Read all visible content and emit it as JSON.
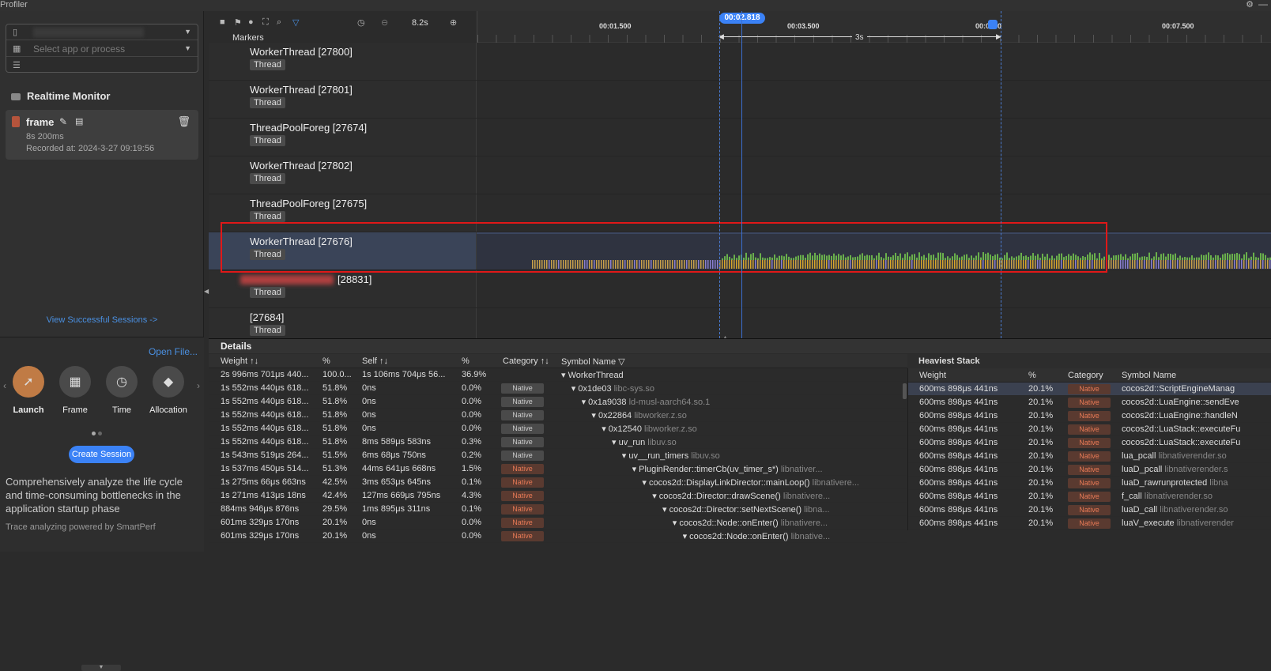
{
  "window": {
    "title": "Profiler"
  },
  "sidebar": {
    "selector_placeholder": "Select app or process",
    "realtime_monitor": "Realtime Monitor",
    "session": {
      "name": "frame",
      "duration": "8s 200ms",
      "recorded": "Recorded at: 2024-3-27 09:19:56"
    },
    "view_sessions": "View Successful Sessions ->",
    "open_file": "Open File...",
    "templates": [
      {
        "label": "Launch",
        "icon": "rocket-icon",
        "glyph": "🚀"
      },
      {
        "label": "Frame",
        "icon": "frame-icon",
        "glyph": "▦"
      },
      {
        "label": "Time",
        "icon": "clock-icon",
        "glyph": "●"
      },
      {
        "label": "Allocation",
        "icon": "cube-icon",
        "glyph": "◆"
      }
    ],
    "create_session": "Create Session",
    "description": "Comprehensively analyze the life cycle and time-consuming bottlenecks in the application startup phase",
    "powered": "Trace analyzing powered by SmartPerf"
  },
  "toolbar": {
    "duration": "8.2s",
    "markers": "Markers"
  },
  "ruler": {
    "ticks": [
      "00:01.500",
      "00:03.500",
      "00:0",
      "500",
      "00:07.500"
    ],
    "cursor": "00:02.818",
    "range": "3s"
  },
  "tracks": [
    {
      "name": "WorkerThread [27800]",
      "tag": "Thread"
    },
    {
      "name": "WorkerThread [27801]",
      "tag": "Thread"
    },
    {
      "name": "ThreadPoolForeg [27674]",
      "tag": "Thread"
    },
    {
      "name": "WorkerThread [27802]",
      "tag": "Thread"
    },
    {
      "name": "ThreadPoolForeg [27675]",
      "tag": "Thread"
    },
    {
      "name": "WorkerThread [27676]",
      "tag": "Thread"
    },
    {
      "name": "[28831]",
      "tag": "Thread"
    },
    {
      "name": "[27684]",
      "tag": "Thread"
    }
  ],
  "details": {
    "title": "Details",
    "columns": [
      "Weight ↑↓",
      "%",
      "Self ↑↓",
      "%",
      "Category ↑↓",
      "Symbol Name ▽"
    ],
    "rows": [
      {
        "w": "2s 996ms 701μs 440...",
        "p": "100.0...",
        "s": "1s 106ms 704μs 56...",
        "sp": "36.9%",
        "cat": "",
        "sym": "▾ WorkerThread",
        "lib": "",
        "indent": 0
      },
      {
        "w": "1s 552ms 440μs 618...",
        "p": "51.8%",
        "s": "0ns",
        "sp": "0.0%",
        "cat": "Native",
        "sym": "▾ 0x1de03",
        "lib": "libc-sys.so",
        "indent": 1
      },
      {
        "w": "1s 552ms 440μs 618...",
        "p": "51.8%",
        "s": "0ns",
        "sp": "0.0%",
        "cat": "Native",
        "sym": "▾ 0x1a9038",
        "lib": "ld-musl-aarch64.so.1",
        "indent": 2
      },
      {
        "w": "1s 552ms 440μs 618...",
        "p": "51.8%",
        "s": "0ns",
        "sp": "0.0%",
        "cat": "Native",
        "sym": "▾ 0x22864",
        "lib": "libworker.z.so",
        "indent": 3
      },
      {
        "w": "1s 552ms 440μs 618...",
        "p": "51.8%",
        "s": "0ns",
        "sp": "0.0%",
        "cat": "Native",
        "sym": "▾ 0x12540",
        "lib": "libworker.z.so",
        "indent": 4
      },
      {
        "w": "1s 552ms 440μs 618...",
        "p": "51.8%",
        "s": "8ms 589μs 583ns",
        "sp": "0.3%",
        "cat": "Native",
        "sym": "▾ uv_run",
        "lib": "libuv.so",
        "indent": 5
      },
      {
        "w": "1s 543ms 519μs 264...",
        "p": "51.5%",
        "s": "6ms 68μs 750ns",
        "sp": "0.2%",
        "cat": "Native",
        "sym": "▾ uv__run_timers",
        "lib": "libuv.so",
        "indent": 6
      },
      {
        "w": "1s 537ms 450μs 514...",
        "p": "51.3%",
        "s": "44ms 641μs 668ns",
        "sp": "1.5%",
        "cat": "Native*",
        "sym": "▾ PluginRender::timerCb(uv_timer_s*)",
        "lib": "libnativer...",
        "indent": 7
      },
      {
        "w": "1s 275ms 66μs 663ns",
        "p": "42.5%",
        "s": "3ms 653μs 645ns",
        "sp": "0.1%",
        "cat": "Native*",
        "sym": "▾ cocos2d::DisplayLinkDirector::mainLoop()",
        "lib": "libnativere...",
        "indent": 8
      },
      {
        "w": "1s 271ms 413μs 18ns",
        "p": "42.4%",
        "s": "127ms 669μs 795ns",
        "sp": "4.3%",
        "cat": "Native*",
        "sym": "▾ cocos2d::Director::drawScene()",
        "lib": "libnativere...",
        "indent": 9
      },
      {
        "w": "884ms 946μs 876ns",
        "p": "29.5%",
        "s": "1ms 895μs 311ns",
        "sp": "0.1%",
        "cat": "Native*",
        "sym": "▾ cocos2d::Director::setNextScene()",
        "lib": "libna...",
        "indent": 10
      },
      {
        "w": "601ms 329μs 170ns",
        "p": "20.1%",
        "s": "0ns",
        "sp": "0.0%",
        "cat": "Native*",
        "sym": "▾ cocos2d::Node::onEnter()",
        "lib": "libnativere...",
        "indent": 11
      },
      {
        "w": "601ms 329μs 170ns",
        "p": "20.1%",
        "s": "0ns",
        "sp": "0.0%",
        "cat": "Native*",
        "sym": "▾ cocos2d::Node::onEnter()",
        "lib": "libnative...",
        "indent": 12
      }
    ]
  },
  "heaviest": {
    "title": "Heaviest Stack",
    "columns": [
      "Weight",
      "%",
      "Category",
      "Symbol Name"
    ],
    "rows": [
      {
        "w": "600ms 898μs 441ns",
        "p": "20.1%",
        "cat": "Native",
        "sym": "cocos2d::ScriptEngineManag",
        "lib": ""
      },
      {
        "w": "600ms 898μs 441ns",
        "p": "20.1%",
        "cat": "Native",
        "sym": "cocos2d::LuaEngine::sendEve",
        "lib": ""
      },
      {
        "w": "600ms 898μs 441ns",
        "p": "20.1%",
        "cat": "Native",
        "sym": "cocos2d::LuaEngine::handleN",
        "lib": ""
      },
      {
        "w": "600ms 898μs 441ns",
        "p": "20.1%",
        "cat": "Native",
        "sym": "cocos2d::LuaStack::executeFu",
        "lib": ""
      },
      {
        "w": "600ms 898μs 441ns",
        "p": "20.1%",
        "cat": "Native",
        "sym": "cocos2d::LuaStack::executeFu",
        "lib": ""
      },
      {
        "w": "600ms 898μs 441ns",
        "p": "20.1%",
        "cat": "Native",
        "sym": "lua_pcall",
        "lib": "libnativerender.so"
      },
      {
        "w": "600ms 898μs 441ns",
        "p": "20.1%",
        "cat": "Native",
        "sym": "luaD_pcall",
        "lib": "libnativerender.s"
      },
      {
        "w": "600ms 898μs 441ns",
        "p": "20.1%",
        "cat": "Native",
        "sym": "luaD_rawrunprotected",
        "lib": "libna"
      },
      {
        "w": "600ms 898μs 441ns",
        "p": "20.1%",
        "cat": "Native",
        "sym": "f_call",
        "lib": "libnativerender.so"
      },
      {
        "w": "600ms 898μs 441ns",
        "p": "20.1%",
        "cat": "Native",
        "sym": "luaD_call",
        "lib": "libnativerender.so"
      },
      {
        "w": "600ms 898μs 441ns",
        "p": "20.1%",
        "cat": "Native",
        "sym": "luaV_execute",
        "lib": "libnativerender"
      }
    ]
  },
  "colors": {
    "accent": "#3b82f6",
    "highlight": "#e01818",
    "native": "#e87a56",
    "activity_green": "#6ab04c",
    "activity_yellow": "#d9a72b"
  }
}
